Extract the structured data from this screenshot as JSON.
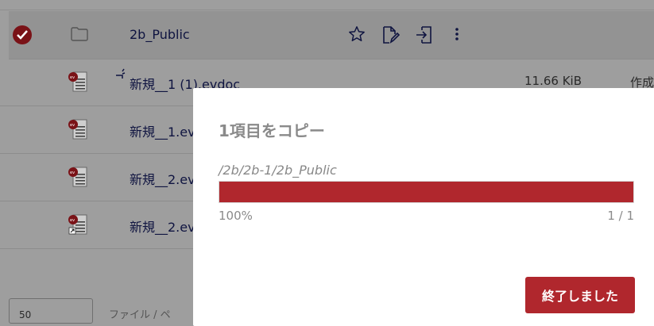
{
  "files": [
    {
      "name": "2b_Public",
      "type": "folder",
      "selected": true,
      "size": "",
      "ctime": ""
    },
    {
      "name": "新規__1 (1).evdoc",
      "type": "evdoc",
      "selected": false,
      "size": "11.66 KiB",
      "ctime": "作成"
    },
    {
      "name": "新規__1.ev",
      "type": "evdoc",
      "selected": false,
      "size": "",
      "ctime": ""
    },
    {
      "name": "新規__2.ev",
      "type": "evdoc",
      "selected": false,
      "size": "",
      "ctime": ""
    },
    {
      "name": "新規__2.ev",
      "type": "evdoc-shortcut",
      "selected": false,
      "size": "",
      "ctime": ""
    }
  ],
  "icons": {
    "check": "check-circle-icon",
    "folder": "folder-icon",
    "star": "star-icon",
    "rename": "rename-icon",
    "move": "move-icon",
    "more": "more-vertical-icon",
    "evdoc": "evdoc-file-icon",
    "shortcut": "shortcut-overlay-icon"
  },
  "bottom": {
    "per_page": "50",
    "label": "ファイル / ペ"
  },
  "dialog": {
    "title": "1項目をコピー",
    "path": "/2b/2b-1/2b_Public",
    "progress": 1.0,
    "percent_label": "100%",
    "count_label": "1 / 1",
    "finish_label": "終了しました"
  },
  "colors": {
    "accent": "#b0272d",
    "overlay": "#9e9e9e",
    "link": "#0f1440"
  }
}
